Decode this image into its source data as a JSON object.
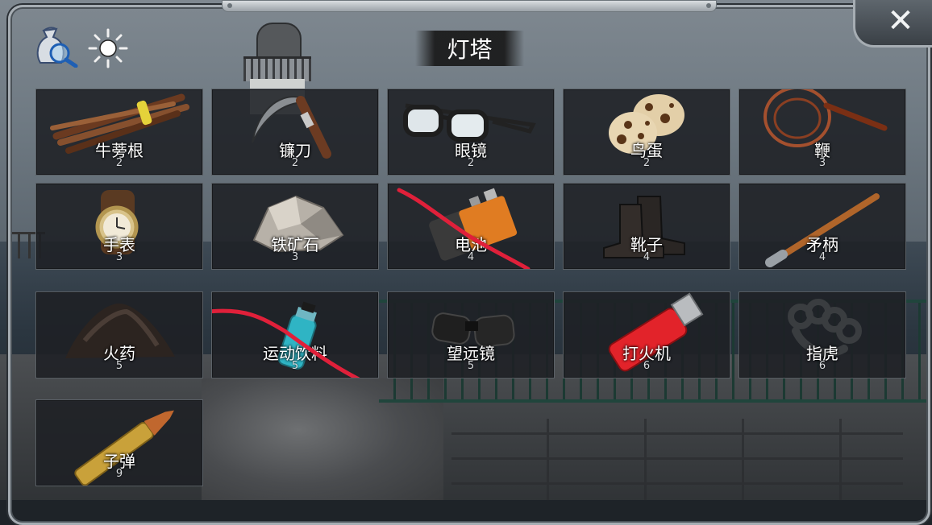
{
  "header": {
    "title": "灯塔",
    "icons": [
      "search-bag-icon",
      "sun-icon"
    ],
    "close_label": "✕"
  },
  "items": [
    {
      "name": "牛蒡根",
      "count": "2",
      "icon": "burdock-root-icon",
      "struck": false
    },
    {
      "name": "镰刀",
      "count": "2",
      "icon": "sickle-icon",
      "struck": false
    },
    {
      "name": "眼镜",
      "count": "2",
      "icon": "glasses-icon",
      "struck": false
    },
    {
      "name": "鸟蛋",
      "count": "2",
      "icon": "bird-egg-icon",
      "struck": false
    },
    {
      "name": "鞭",
      "count": "3",
      "icon": "whip-icon",
      "struck": false
    },
    {
      "name": "手表",
      "count": "3",
      "icon": "watch-icon",
      "struck": false
    },
    {
      "name": "铁矿石",
      "count": "3",
      "icon": "iron-ore-icon",
      "struck": false
    },
    {
      "name": "电池",
      "count": "4",
      "icon": "battery-icon",
      "struck": true
    },
    {
      "name": "靴子",
      "count": "4",
      "icon": "boots-icon",
      "struck": false
    },
    {
      "name": "矛柄",
      "count": "4",
      "icon": "spear-shaft-icon",
      "struck": false
    },
    {
      "name": "火药",
      "count": "5",
      "icon": "gunpowder-icon",
      "struck": false
    },
    {
      "name": "运动饮料",
      "count": "5",
      "icon": "sports-drink-icon",
      "struck": true
    },
    {
      "name": "望远镜",
      "count": "5",
      "icon": "binoculars-icon",
      "struck": false
    },
    {
      "name": "打火机",
      "count": "6",
      "icon": "lighter-icon",
      "struck": false
    },
    {
      "name": "指虎",
      "count": "6",
      "icon": "brass-knuckles-icon",
      "struck": false
    },
    {
      "name": "子弹",
      "count": "9",
      "icon": "bullet-icon",
      "struck": false
    }
  ],
  "colors": {
    "strike": "#e0203a",
    "cell_bg": "#1f2125",
    "frame": "#a6adb3"
  }
}
